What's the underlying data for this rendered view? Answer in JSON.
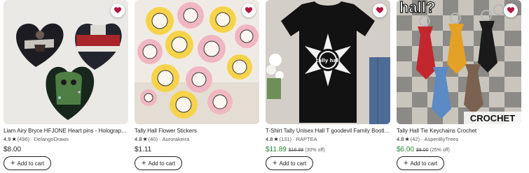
{
  "cart_label": "Add to cart",
  "plus_glyph": "+",
  "star_glyph": "★",
  "dot_glyph": "·",
  "colors": {
    "sale_price": "#258635",
    "fav_heart": "#b71540"
  },
  "listings": [
    {
      "title": "Liam Airy Bryce HFJONE Heart pins - Holographic",
      "rating": "4.9",
      "reviews": "(496)",
      "shop": "DelangoDraws",
      "price": "$8.00",
      "original_price": "",
      "discount": "",
      "image_icon": "heart-pins-photo"
    },
    {
      "title": "Tally Hall Flower Stickers",
      "rating": "4.8",
      "reviews": "(40)",
      "shop": "Aurorakeira",
      "price": "$1.11",
      "original_price": "",
      "discount": "",
      "image_icon": "flower-stickers-photo"
    },
    {
      "title": "T-Shirt Tally Unisex Hall T goodevil Family Bootleg",
      "rating": "4.8",
      "reviews": "(131)",
      "shop": "RAPTEA",
      "price": "$11.89",
      "original_price": "$16.99",
      "discount": "(30% off)",
      "image_icon": "tshirt-photo",
      "shirt_text": "tally hall"
    },
    {
      "title": "Tally Hall Tie Keychains Crochet",
      "rating": "4.8",
      "reviews": "(42)",
      "shop": "AspenByTrees",
      "price": "$6.00",
      "original_price": "$8.00",
      "discount": "(25% off)",
      "image_icon": "crochet-ties-photo",
      "overlay_top": "hall?",
      "overlay_bottom": "CROCHET"
    }
  ]
}
